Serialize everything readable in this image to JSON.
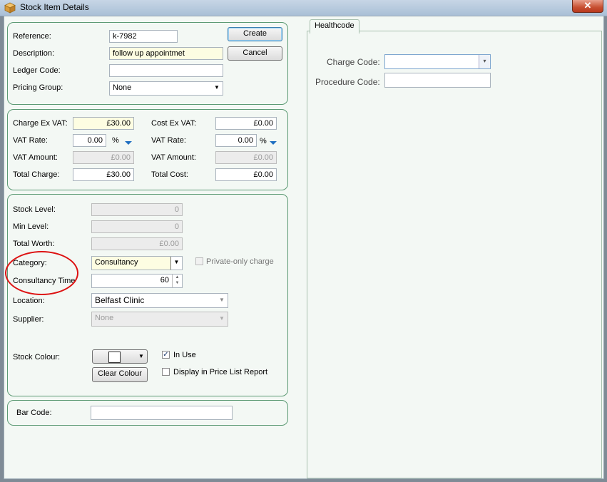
{
  "window": {
    "title": "Stock Item Details",
    "close_glyph": "✕"
  },
  "buttons": {
    "create": "Create",
    "cancel": "Cancel",
    "clear_colour": "Clear Colour"
  },
  "details": {
    "reference_label": "Reference:",
    "reference_value": "k-7982",
    "description_label": "Description:",
    "description_value": "follow up appointmet",
    "ledger_label": "Ledger Code:",
    "ledger_value": "",
    "pricing_label": "Pricing Group:",
    "pricing_value": "None"
  },
  "pricing": {
    "charge_ex_vat_label": "Charge Ex VAT:",
    "charge_ex_vat": "£30.00",
    "vat_rate_label": "VAT Rate:",
    "vat_rate": "0.00",
    "percent": "%",
    "vat_amount_label": "VAT Amount:",
    "vat_amount": "£0.00",
    "total_charge_label": "Total Charge:",
    "total_charge": "£30.00",
    "cost_ex_vat_label": "Cost Ex VAT:",
    "cost_ex_vat": "£0.00",
    "cost_vat_rate_label": "VAT Rate:",
    "cost_vat_rate": "0.00",
    "cost_vat_amount_label": "VAT Amount:",
    "cost_vat_amount": "£0.00",
    "total_cost_label": "Total Cost:",
    "total_cost": "£0.00"
  },
  "stock": {
    "stock_level_label": "Stock Level:",
    "stock_level": "0",
    "min_level_label": "Min Level:",
    "min_level": "0",
    "total_worth_label": "Total Worth:",
    "total_worth": "£0.00",
    "category_label": "Category:",
    "category_value": "Consultancy",
    "private_only_label": "Private-only charge",
    "private_only_checked": false,
    "consultancy_time_label": "Consultancy Time",
    "consultancy_time": "60",
    "location_label": "Location:",
    "location_value": "Belfast Clinic",
    "supplier_label": "Supplier:",
    "supplier_value": "None",
    "stock_colour_label": "Stock Colour:",
    "in_use_label": "In Use",
    "in_use_checked": true,
    "check_glyph": "✓",
    "display_price_list_label": "Display in Price List Report",
    "display_price_list_checked": false
  },
  "barcode": {
    "label": "Bar Code:",
    "value": ""
  },
  "healthcode": {
    "tab_label": "Healthcode",
    "charge_code_label": "Charge Code:",
    "charge_code_value": "",
    "procedure_code_label": "Procedure Code:",
    "procedure_code_value": ""
  },
  "colors": {
    "panel_border": "#5c9a74",
    "annotation_ellipse": "#dd1111",
    "required_field_bg": "#fdfde2"
  }
}
